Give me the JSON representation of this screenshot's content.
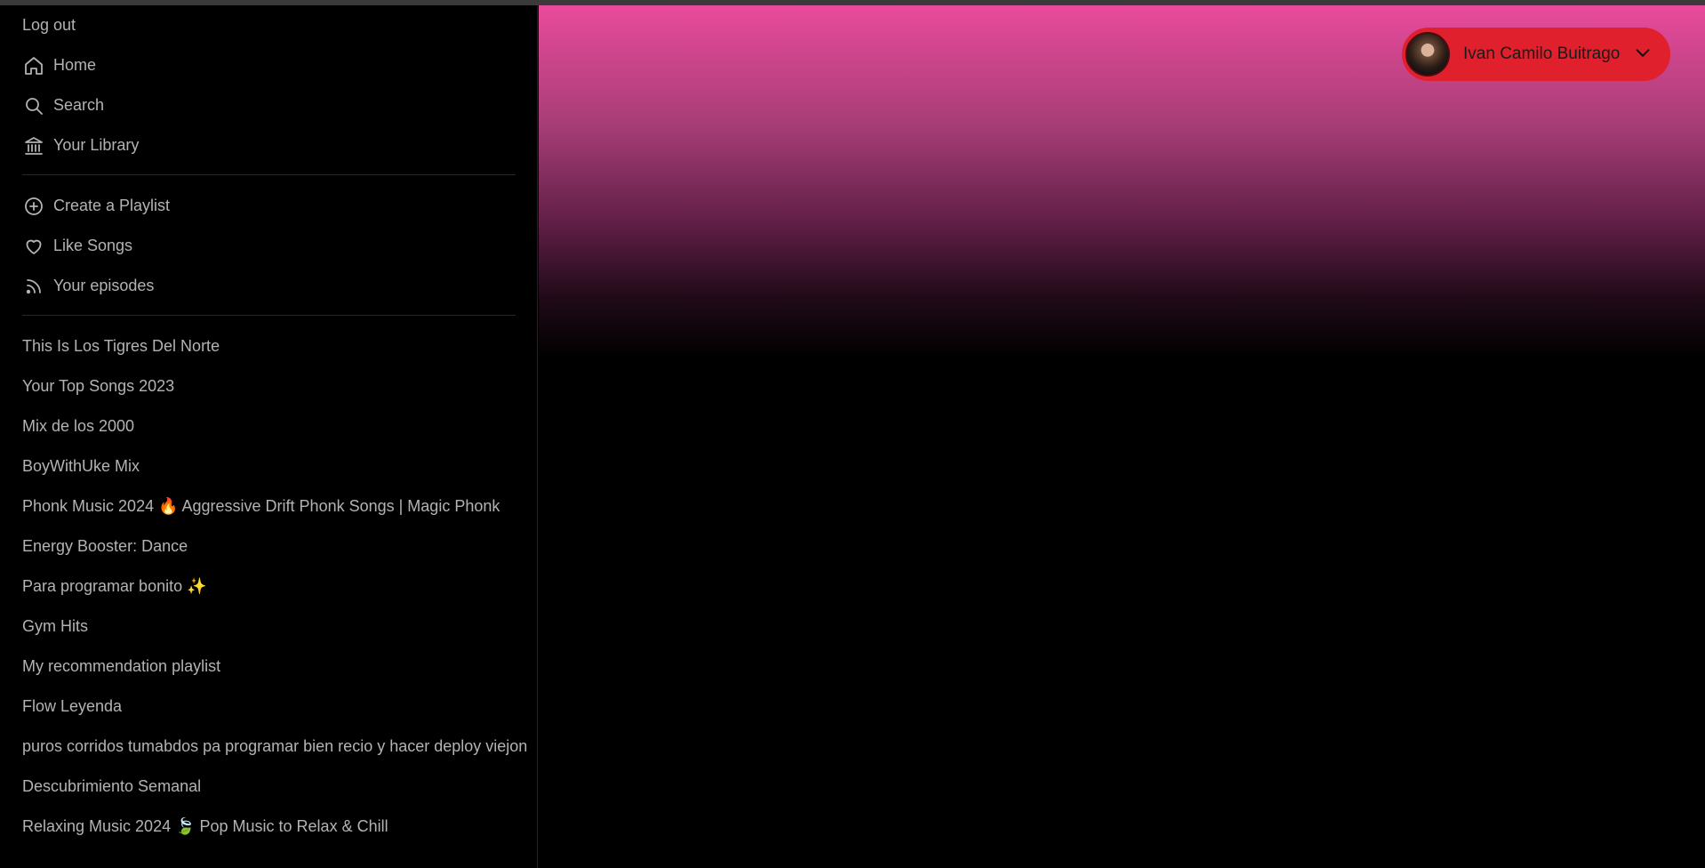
{
  "nav": {
    "logout": "Log out",
    "primary": [
      {
        "label": "Home",
        "icon": "home-icon"
      },
      {
        "label": "Search",
        "icon": "search-icon"
      },
      {
        "label": "Your Library",
        "icon": "library-icon"
      }
    ],
    "secondary": [
      {
        "label": "Create a Playlist",
        "icon": "plus-circle-icon"
      },
      {
        "label": "Like Songs",
        "icon": "heart-icon"
      },
      {
        "label": "Your episodes",
        "icon": "rss-icon"
      }
    ]
  },
  "playlists": [
    "This Is Los Tigres Del Norte",
    "Your Top Songs 2023",
    "Mix de los 2000",
    "BoyWithUke Mix",
    "Phonk Music 2024 🔥 Aggressive Drift Phonk Songs | Magic Phonk",
    "Energy Booster: Dance",
    "Para programar bonito ✨",
    "Gym Hits",
    "My recommendation playlist",
    "Flow Leyenda",
    "puros corridos tumabdos pa programar bien recio y hacer deploy viejon",
    "Descubrimiento Semanal",
    "Relaxing Music 2024 🍃 Pop Music to Relax & Chill"
  ],
  "user": {
    "name": "Ivan Camilo Buitrago",
    "pill_color": "#e0202d",
    "avatar_icon": "avatar"
  },
  "theme": {
    "gradient_top": "#e94b9c",
    "background": "#000000",
    "text": "#b3b3b3"
  }
}
